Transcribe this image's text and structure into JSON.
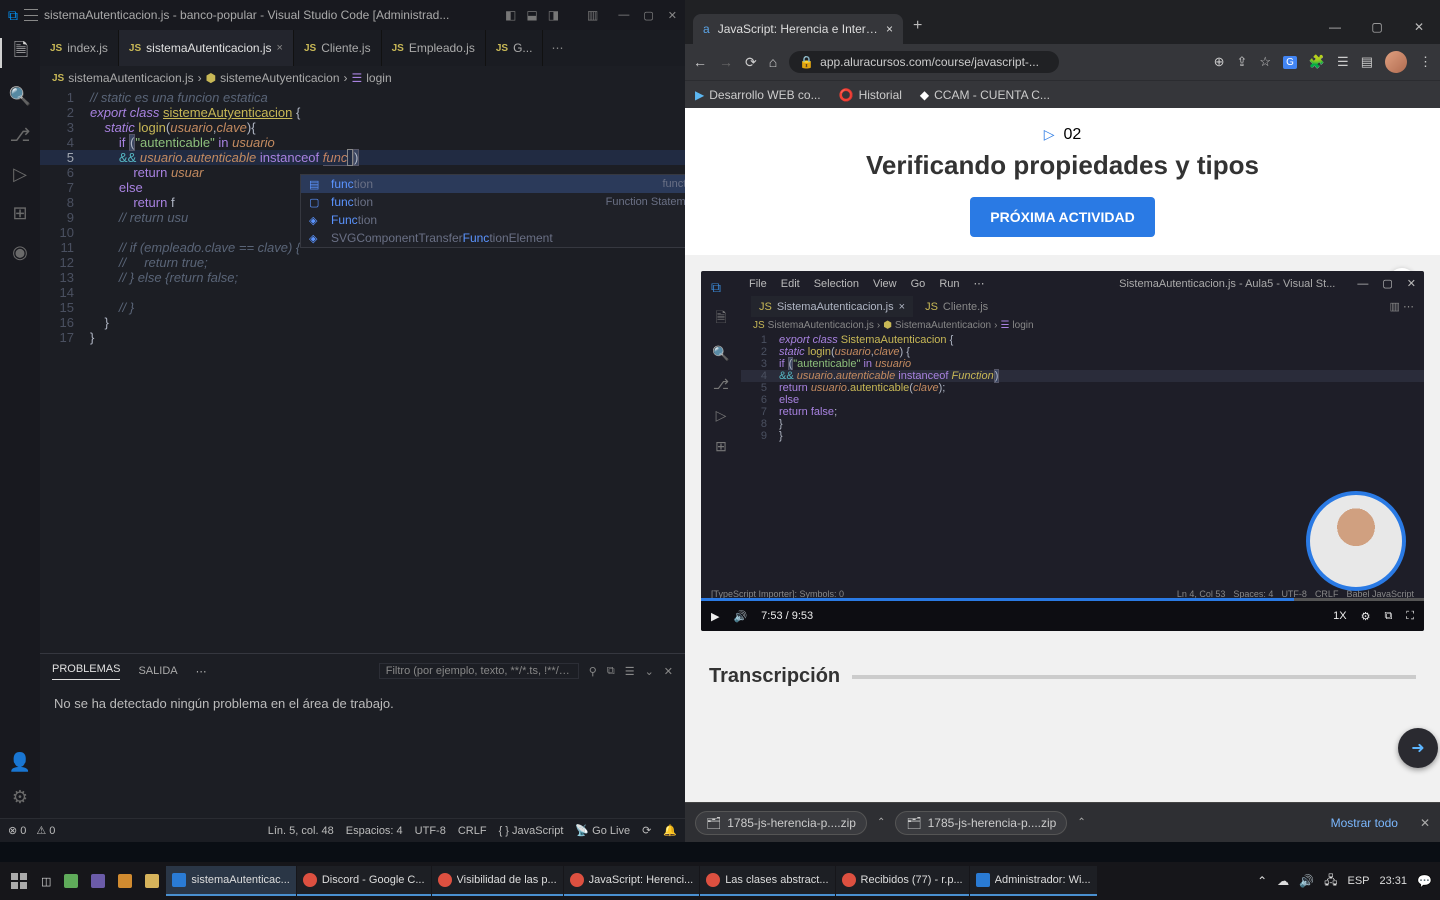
{
  "vscode": {
    "title": "sistemaAutenticacion.js - banco-popular - Visual Studio Code [Administrad...",
    "tabs": [
      "index.js",
      "sistemaAutenticacion.js",
      "Cliente.js",
      "Empleado.js",
      "G..."
    ],
    "activeTab": 1,
    "breadcrumbs": [
      "sistemaAutenticacion.js",
      "sistemeAutyenticacion",
      "login"
    ],
    "code": {
      "l1": "// static es una funcion estatica",
      "l2_kw1": "export",
      "l2_kw2": "class",
      "l2_cls": "sistemeAutyenticacion",
      "l2_brace": "{",
      "l3_kw": "static",
      "l3_fn": "login",
      "l3_p1": "usuario",
      "l3_p2": "clave",
      "l3_brace": "){",
      "l4_kw": "if",
      "l4_str": "\"autenticable\"",
      "l4_in": "in",
      "l4_var": "usuario",
      "l5_op": "&&",
      "l5_v1": "usuario",
      "l5_dot": ".",
      "l5_v2": "autenticable",
      "l5_inst": "instanceof",
      "l5_func": "func",
      "l5_close": ")",
      "l6_kw": "return",
      "l6_v": "usuar",
      "l7_kw": "else",
      "l8_kw": "return",
      "l8_v": "f",
      "l9_cmt": "// return usu",
      "l10": "",
      "l11_cmt": "// if (empleado.clave == clave) {",
      "l12_cmt": "//     return true;",
      "l13_cmt": "// } else {return false;",
      "l14": "",
      "l15_cmt": "// }",
      "l16_brace": "}",
      "l17_brace": "}"
    },
    "autocomplete": {
      "items": [
        {
          "match": "func",
          "rest": "tion",
          "hint": "function",
          "sel": true
        },
        {
          "match": "func",
          "rest": "tion",
          "hint": "Function Statement"
        },
        {
          "match": "Func",
          "rest": "tion",
          "hint": ""
        }
      ],
      "svgRow": {
        "prefix": "SVGComponentTransfer",
        "match": "Func",
        "rest": "tionElement"
      }
    },
    "panel": {
      "tabs": [
        "PROBLEMAS",
        "SALIDA"
      ],
      "filterPlaceholder": "Filtro (por ejemplo, texto, **/*.ts, !**/node_modul...",
      "body": "No se ha detectado ningún problema en el área de trabajo."
    },
    "status": {
      "errors": "⊗ 0",
      "warnings": "⚠ 0",
      "right": [
        "Lín. 5, col. 48",
        "Espacios: 4",
        "UTF-8",
        "CRLF",
        "{ } JavaScript",
        "📡 Go Live",
        "⟳",
        "🔔"
      ]
    }
  },
  "chrome": {
    "tab": "JavaScript: Herencia e Interfaces e",
    "url": "app.aluracursos.com/course/javascript-...",
    "bookmarks": [
      {
        "icon": "▶",
        "label": "Desarrollo WEB co..."
      },
      {
        "icon": "⭕",
        "label": "Historial"
      },
      {
        "icon": "◆",
        "label": "CCAM - CUENTA C..."
      }
    ],
    "lesson": {
      "num": "02",
      "title": "Verificando propiedades y tipos",
      "button": "PRÓXIMA ACTIVIDAD"
    },
    "video": {
      "menus": [
        "File",
        "Edit",
        "Selection",
        "View",
        "Go",
        "Run",
        "⋯"
      ],
      "title": "SistemaAutenticacion.js - Aula5 - Visual St...",
      "tabs": [
        {
          "name": "SistemaAutenticacion.js",
          "close": true
        },
        {
          "name": "Cliente.js"
        }
      ],
      "bc": [
        "SistemaAutenticacion.js",
        "SistemaAutenticacion",
        "login"
      ],
      "time": "7:53  /  9:53",
      "speed": "1X",
      "status": {
        "ts": "[TypeScript Importer]: Symbols: 0",
        "lncol": "Ln 4, Col 53",
        "spaces": "Spaces: 4",
        "enc": "UTF-8",
        "eol": "CRLF",
        "lang": "Babel JavaScript"
      }
    },
    "transcription": "Transcripción",
    "downloads": [
      "1785-js-herencia-p....zip",
      "1785-js-herencia-p....zip"
    ],
    "showAll": "Mostrar todo"
  },
  "taskbar": {
    "apps": [
      {
        "label": "sistemaAutenticac...",
        "ic": "#2a7bd4"
      },
      {
        "label": "Discord - Google C...",
        "ic": "#dd5040"
      },
      {
        "label": "Visibilidad de las p...",
        "ic": "#dd5040"
      },
      {
        "label": "JavaScript: Herenci...",
        "ic": "#dd5040"
      },
      {
        "label": "Las clases abstract...",
        "ic": "#dd5040"
      },
      {
        "label": "Recibidos (77) - r.p...",
        "ic": "#dd5040"
      },
      {
        "label": "Administrador: Wi...",
        "ic": "#2a7bd4"
      }
    ],
    "tray": {
      "lang": "ESP",
      "time": "23:31"
    }
  }
}
